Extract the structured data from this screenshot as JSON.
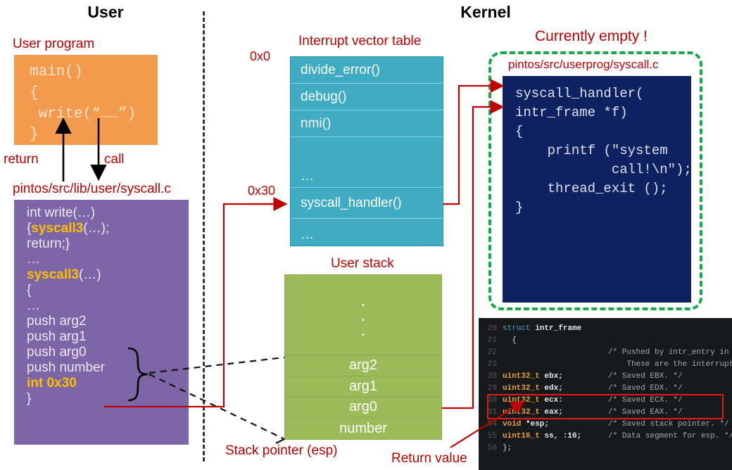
{
  "headers": {
    "user": "User",
    "kernel": "Kernel"
  },
  "colors": {
    "orange": "#F49A4C",
    "purple": "#7D66A8",
    "teal": "#3FACC4",
    "green_stack": "#9BBB59",
    "navy": "#0E2160",
    "red_label": "#C00000",
    "green_dash": "#17A84A",
    "highlight_red": "#E01B1B",
    "terminal_bg": "#17191A"
  },
  "user_side": {
    "program_label": "User program",
    "program_code": "main()\n{\n write(“……”)\n}",
    "return_label": "return",
    "call_label": "call",
    "syscall_path_label": "pintos/src/lib/user/syscall.c",
    "syscall_code_lines": [
      {
        "text": "int write(…)",
        "kw": ""
      },
      {
        "text": "{syscall3(…);",
        "kw": "syscall3"
      },
      {
        "text": "return;}",
        "kw": ""
      },
      {
        "text": "…",
        "kw": ""
      },
      {
        "text": "syscall3(…)",
        "kw": "syscall3"
      },
      {
        "text": "{",
        "kw": ""
      },
      {
        "text": "…",
        "kw": ""
      },
      {
        "text": "push arg2",
        "kw": ""
      },
      {
        "text": "push arg1",
        "kw": ""
      },
      {
        "text": "push arg0",
        "kw": ""
      },
      {
        "text": "push number",
        "kw": ""
      },
      {
        "text": "int 0x30",
        "kw": "int 0x30"
      },
      {
        "text": "}",
        "kw": ""
      }
    ]
  },
  "vector_table": {
    "title": "Interrupt vector table",
    "addr_top": "0x0",
    "addr_syscall": "0x30",
    "rows": [
      "divide_error()",
      "debug()",
      "nmi()",
      "…",
      "syscall_handler()",
      "…"
    ]
  },
  "user_stack": {
    "title": "User stack",
    "dots": ".",
    "rows": [
      "arg2",
      "arg1",
      "arg0",
      "number"
    ],
    "esp_label": "Stack pointer (esp)",
    "return_value_label": "Return value"
  },
  "kernel_side": {
    "empty_note": "Currently empty !",
    "path_label": "pintos/src/userprog/syscall.c",
    "handler_code": "syscall_handler(\nintr_frame *f)\n{\n    printf (\"system\n            call!\\n\");\n    thread_exit ();\n}"
  },
  "terminal": {
    "lines": [
      {
        "num": "20",
        "code": "struct intr_frame",
        "code_kw": "struct",
        "comment": ""
      },
      {
        "num": "21",
        "code": "  {",
        "code_kw": "",
        "comment": ""
      },
      {
        "num": "22",
        "code": "",
        "code_kw": "",
        "comment": "/* Pushed by intr_entry in intr-stubs.S."
      },
      {
        "num": "23",
        "code": "",
        "code_kw": "",
        "comment": "    These are the interrupted task's saved registers. */"
      },
      {
        "num": "28",
        "code": "uint32_t ebx;",
        "code_kw": "uint32_t",
        "comment": "/* Saved EBX. */"
      },
      {
        "num": "29",
        "code": "uint32_t edx;",
        "code_kw": "uint32_t",
        "comment": "/* Saved EDX. */"
      },
      {
        "num": "30",
        "code": "uint32_t ecx:",
        "code_kw": "uint32_t",
        "comment": "/* Saved ECX. */"
      },
      {
        "num": "31",
        "code": "uint32_t eax;",
        "code_kw": "uint32_t",
        "comment": "/* Saved EAX. */"
      },
      {
        "num": "54",
        "code": "void *esp;",
        "code_kw": "void",
        "comment": "/* Saved stack pointer. */"
      },
      {
        "num": "55",
        "code": "uint16_t ss, :16;",
        "code_kw": "uint16_t",
        "comment": "/* Data segment for esp. */"
      },
      {
        "num": "56",
        "code": "};",
        "code_kw": "",
        "comment": ""
      }
    ]
  }
}
